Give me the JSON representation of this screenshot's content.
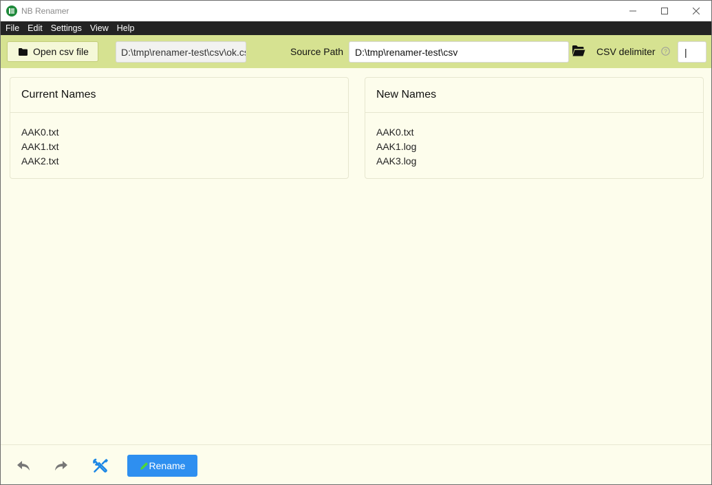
{
  "window": {
    "title": "NB Renamer"
  },
  "menu": [
    "File",
    "Edit",
    "Settings",
    "View",
    "Help"
  ],
  "toolbar": {
    "open_csv_label": "Open csv file",
    "csv_file_path": "D:\\tmp\\renamer-test\\csv\\ok.csv",
    "source_path_label": "Source Path",
    "source_path_value": "D:\\tmp\\renamer-test\\csv",
    "csv_delimiter_label": "CSV delimiter",
    "csv_delimiter_value": "|"
  },
  "current_names": {
    "title": "Current Names",
    "items": [
      "AAK0.txt",
      "AAK1.txt",
      "AAK2.txt"
    ]
  },
  "new_names": {
    "title": "New Names",
    "items": [
      "AAK0.txt",
      "AAK1.log",
      "AAK3.log"
    ]
  },
  "bottom": {
    "rename_label": "Rename"
  },
  "colors": {
    "toolbar_bg": "#d6e291",
    "content_bg": "#fdfdec",
    "menubar_bg": "#232323",
    "rename_button": "#2e8ff0",
    "tools_icon": "#1e88e5",
    "app_icon": "#1f8a3b"
  },
  "icons": [
    "app-logo-icon",
    "minimize-icon",
    "maximize-icon",
    "close-icon",
    "folder-icon",
    "folder-open-icon",
    "help-circle-icon",
    "undo-icon",
    "redo-icon",
    "tools-icon",
    "pencil-icon"
  ]
}
